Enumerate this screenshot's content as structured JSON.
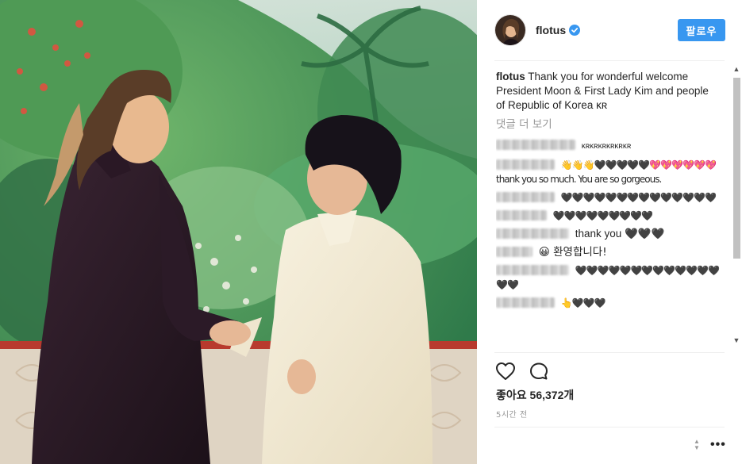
{
  "post": {
    "username": "flotus",
    "verified": true,
    "follow_label": "팔로우",
    "caption_user": "flotus",
    "caption_text": "Thank you for wonderful welcome President Moon & First Lady Kim and people of Republic of Korea ᴋʀ",
    "view_more_comments": "댓글 더 보기",
    "comments": [
      {
        "text": "ᴋʀᴋʀᴋʀᴋʀᴋʀᴋʀ"
      },
      {
        "text": "👋👋👋🖤🖤🖤🖤🖤💖💖💖💖💖💖thank you so much. You are so gorgeous."
      },
      {
        "text": "🖤🖤🖤🖤🖤🖤🖤🖤🖤🖤🖤🖤🖤🖤"
      },
      {
        "text": "🖤🖤🖤🖤🖤🖤🖤🖤🖤"
      },
      {
        "text": "thank you 🖤🖤🖤"
      },
      {
        "text": "😀 환영합니다!"
      },
      {
        "text": "🖤🖤🖤🖤🖤🖤🖤🖤🖤🖤🖤🖤🖤🖤🖤"
      },
      {
        "text": "👆🖤🖤🖤"
      }
    ],
    "likes_label": "좋아요",
    "likes_count": "56,372개",
    "time_ago": "5시간 전"
  },
  "colors": {
    "follow_button": "#3897f0",
    "muted_text": "#999999",
    "verified_badge": "#3897f0"
  },
  "icons": [
    "heart-icon",
    "comment-icon",
    "verified-badge-icon",
    "more-options-icon"
  ]
}
